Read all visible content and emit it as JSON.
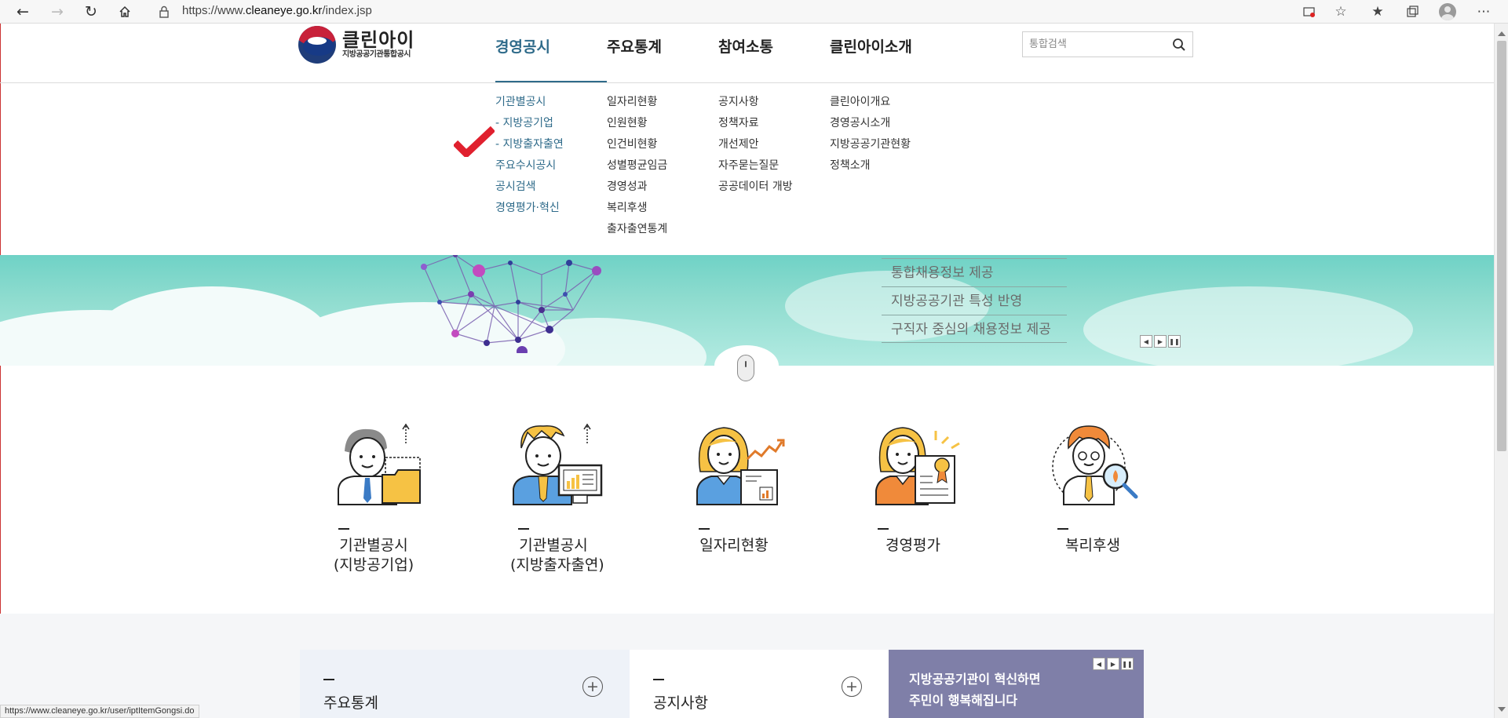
{
  "browser": {
    "url_prefix": "https://www.",
    "url_host": "cleaneye.go.kr",
    "url_path": "/index.jsp",
    "status_url": "https://www.cleaneye.go.kr/user/iptItemGongsi.do"
  },
  "logo": {
    "name": "클린아이",
    "subtitle": "지방공공기관통합공시"
  },
  "gnb": [
    {
      "label": "경영공시",
      "active": true
    },
    {
      "label": "주요통계",
      "active": false
    },
    {
      "label": "참여소통",
      "active": false
    },
    {
      "label": "클린아이소개",
      "active": false
    }
  ],
  "search": {
    "placeholder": "통합검색"
  },
  "mega_menu": {
    "col1": [
      "기관별공시",
      "- 지방공기업",
      "- 지방출자출연",
      "주요수시공시",
      "공시검색",
      "경영평가·혁신"
    ],
    "col2": [
      "일자리현황",
      "인원현황",
      "인건비현황",
      "성별평균임금",
      "경영성과",
      "복리후생",
      "출자출연통계"
    ],
    "col3": [
      "공지사항",
      "정책자료",
      "개선제안",
      "자주묻는질문",
      "공공데이터 개방"
    ],
    "col4": [
      "클린아이개요",
      "경영공시소개",
      "지방공공기관현황",
      "정책소개"
    ]
  },
  "banner": {
    "items": [
      "통합채용정보 제공",
      "지방공공기관 특성 반영",
      "구직자 중심의 채용정보 제공"
    ]
  },
  "quick_links": [
    {
      "line1": "기관별공시",
      "line2": "(지방공기업)"
    },
    {
      "line1": "기관별공시",
      "line2": "(지방출자출연)"
    },
    {
      "line1": "일자리현황",
      "line2": ""
    },
    {
      "line1": "경영평가",
      "line2": ""
    },
    {
      "line1": "복리후생",
      "line2": ""
    }
  ],
  "bottom": {
    "stats_title": "주요통계",
    "notice_title": "공지사항",
    "promo_line1": "지방공공기관이 혁신하면",
    "promo_line2": "주민이 행복해집니다"
  },
  "colors": {
    "accent": "#2f6b8a",
    "check_red": "#e0202e",
    "banner_teal": "#8fdccf",
    "promo_purple": "#7f7fa8"
  }
}
